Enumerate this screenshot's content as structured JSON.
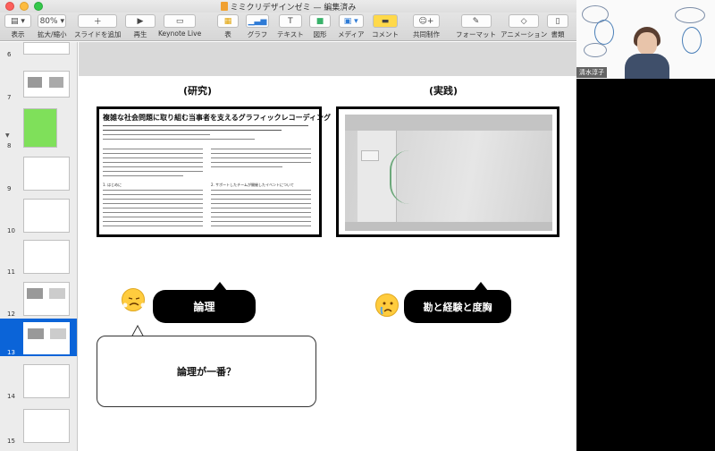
{
  "window": {
    "title": "ミミクリデザインゼミ — 編集済み"
  },
  "toolbar": {
    "view_label": "表示",
    "zoom_value": "80%",
    "zoom_label": "拡大/縮小",
    "add_slide_label": "スライドを追加",
    "play_label": "再生",
    "keynote_live_label": "Keynote Live",
    "table_label": "表",
    "chart_label": "グラフ",
    "text_label": "テキスト",
    "shape_label": "図形",
    "media_label": "メディア",
    "comment_label": "コメント",
    "collaborate_label": "共同制作",
    "format_label": "フォーマット",
    "animate_label": "アニメーション",
    "document_label": "書類"
  },
  "sidebar": {
    "slides": [
      {
        "num": "6",
        "text": ""
      },
      {
        "num": "7",
        "text": ""
      },
      {
        "num": "8",
        "text": ""
      },
      {
        "num": "9",
        "text": ""
      },
      {
        "num": "10",
        "text": ""
      },
      {
        "num": "11",
        "text": ""
      },
      {
        "num": "12",
        "text": ""
      },
      {
        "num": "13",
        "text": ""
      },
      {
        "num": "14",
        "text": ""
      },
      {
        "num": "15",
        "text": ""
      }
    ]
  },
  "slide": {
    "left_header": "(研究)",
    "right_header": "(実践)",
    "paper": {
      "title": "複雑な社会問題に取り組む当事者を支えるグラフィックレコーディング",
      "section1": "1. はじめに",
      "section2": "2. サポートしたチームが開催したイベントについて"
    },
    "logic_pill": "論理",
    "intuition_pill": "勘と経験と度胸",
    "bubble_text": "論理が一番？"
  },
  "video": {
    "name": "清水淳子"
  },
  "colors": {
    "selection": "#0b64d8",
    "slide_thumb_green": "#7fe05a"
  }
}
